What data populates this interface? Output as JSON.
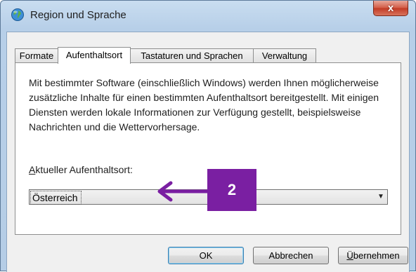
{
  "window": {
    "title": "Region und Sprache",
    "close_symbol": "x"
  },
  "tabs": [
    {
      "label": "Formate",
      "active": false
    },
    {
      "label": "Aufenthaltsort",
      "active": true
    },
    {
      "label": "Tastaturen und Sprachen",
      "active": false
    },
    {
      "label": "Verwaltung",
      "active": false
    }
  ],
  "panel": {
    "description": "Mit bestimmter Software (einschließlich Windows) werden Ihnen möglicherweise zusätzliche Inhalte für einen bestimmten Aufenthaltsort bereitgestellt. Mit einigen Diensten werden lokale Informationen zur Verfügung gestellt, beispielsweise Nachrichten und die Wettervorhersage.",
    "location_label_mnemonic": "A",
    "location_label_rest": "ktueller Aufenthaltsort:",
    "location_value": "Österreich"
  },
  "annotation": {
    "badge": "2",
    "color": "#7a1fa2"
  },
  "buttons": {
    "ok": "OK",
    "cancel": "Abbrechen",
    "apply_mnemonic": "Ü",
    "apply_rest": "bernehmen"
  }
}
